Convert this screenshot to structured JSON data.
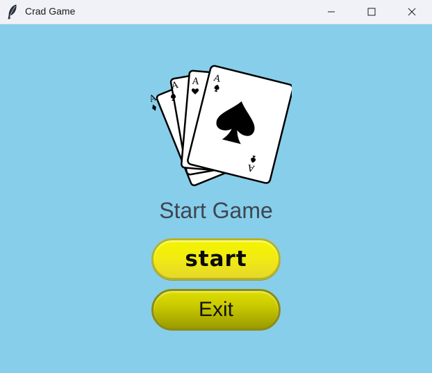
{
  "window": {
    "title": "Crad Game",
    "icon": "feather-icon",
    "controls": [
      "minimize-icon",
      "maximize-icon",
      "close-icon"
    ],
    "background_color": "#87ceeb"
  },
  "main": {
    "image": "playing-cards-aces-icon",
    "heading": "Start Game",
    "start_button_label": "start",
    "exit_button_label": "Exit",
    "accent_color": "#f2ec10"
  }
}
